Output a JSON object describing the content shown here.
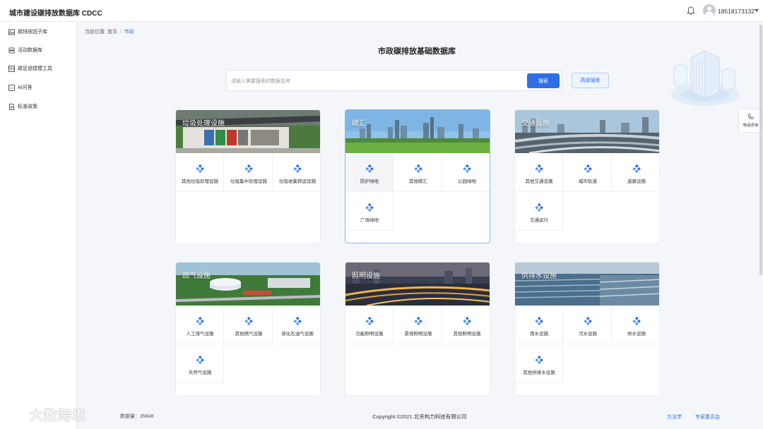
{
  "app": {
    "title": "城市建设碳排放数据库 CDCC"
  },
  "user": {
    "phone": "18518173132"
  },
  "sidebar": {
    "items": [
      {
        "label": "碳排放因子库",
        "icon": "image-icon"
      },
      {
        "label": "活动数据库",
        "icon": "database-icon"
      },
      {
        "label": "碳足迹建模工具",
        "icon": "calculator-icon"
      },
      {
        "label": "AI问答",
        "icon": "ai-icon"
      },
      {
        "label": "标准政策",
        "icon": "document-icon"
      }
    ]
  },
  "breadcrumb": {
    "prefix": "当前位置:",
    "home": "首页",
    "sep": "/",
    "current": "市政"
  },
  "page": {
    "title": "市政碳排放基础数据库"
  },
  "search": {
    "placeholder": "请输入需要搜索的数据名称",
    "button": "搜索",
    "advanced": "高级搜索"
  },
  "float": {
    "label": "电话咨询"
  },
  "categories": [
    {
      "title": "垃圾处理设施",
      "items": [
        "其他垃圾处理设施",
        "垃圾集中处理设施",
        "垃圾收集转运设施"
      ]
    },
    {
      "title": "碳汇",
      "items": [
        "防护绿地",
        "其他碳汇",
        "公园绿地",
        "广场绿地"
      ]
    },
    {
      "title": "交通设施",
      "items": [
        "其他交通设施",
        "城市轨道",
        "道路设施",
        "交通运行"
      ]
    },
    {
      "title": "燃气设施",
      "items": [
        "人工煤气设施",
        "其他燃气设施",
        "液化石油气设施",
        "天然气设施"
      ]
    },
    {
      "title": "照明设施",
      "items": [
        "功能照明设施",
        "景观照明设施",
        "其他照明设施"
      ]
    },
    {
      "title": "供排水设施",
      "items": [
        "雨水设施",
        "污水设施",
        "供水设施",
        "其他供排水设施"
      ]
    }
  ],
  "footer": {
    "data_count": "数据量：35848",
    "copyright": "Copyright ©2021 北京构力科技有限公司",
    "link_method": "方法学",
    "link_experts": "专家委员会",
    "watermark": "大数跨境"
  },
  "colors": {
    "accent": "#2f6fe4",
    "selected_border": "#8fb4ec"
  }
}
